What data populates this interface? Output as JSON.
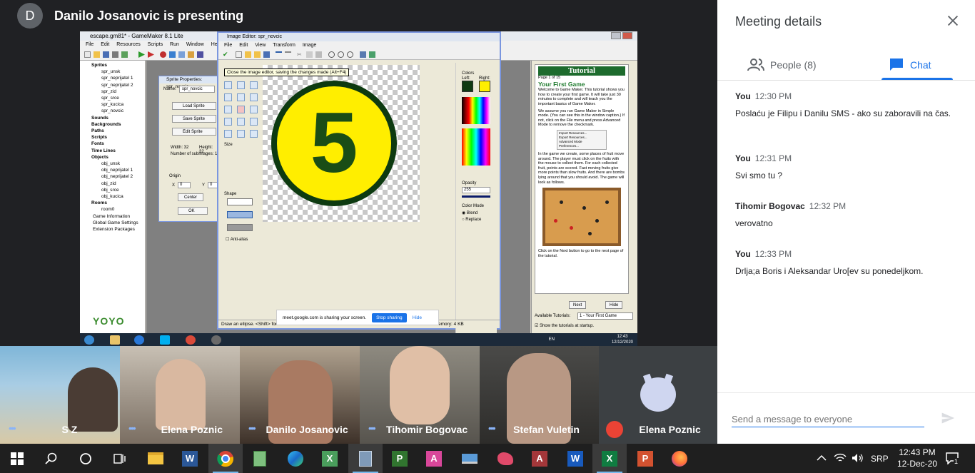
{
  "presenter": {
    "avatar_letter": "D",
    "text": "Danilo Josanovic is presenting"
  },
  "shared_screen": {
    "gm_title": "escape.gm81* - GameMaker 8.1 Lite",
    "gm_menu": [
      "File",
      "Edit",
      "Resources",
      "Scripts",
      "Run",
      "Window",
      "Help"
    ],
    "tree": [
      {
        "label": "Sprites",
        "bold": true
      },
      {
        "label": "spr_unsk",
        "indent": 2
      },
      {
        "label": "spr_neprijatel 1",
        "indent": 2
      },
      {
        "label": "spr_neprijatel 2",
        "indent": 2
      },
      {
        "label": "spr_zid",
        "indent": 2
      },
      {
        "label": "spr_srce",
        "indent": 2
      },
      {
        "label": "spr_kucica",
        "indent": 2
      },
      {
        "label": "spr_novcic",
        "indent": 2
      },
      {
        "label": "Sounds",
        "bold": true
      },
      {
        "label": "Backgrounds",
        "bold": true
      },
      {
        "label": "Paths",
        "bold": true
      },
      {
        "label": "Scripts",
        "bold": true
      },
      {
        "label": "Fonts",
        "bold": true
      },
      {
        "label": "Time Lines",
        "bold": true
      },
      {
        "label": "Objects",
        "bold": true
      },
      {
        "label": "obj_unsk",
        "indent": 2
      },
      {
        "label": "obj_neprijatel 1",
        "indent": 2
      },
      {
        "label": "obj_neprijatel 2",
        "indent": 2
      },
      {
        "label": "obj_zid",
        "indent": 2
      },
      {
        "label": "obj_srce",
        "indent": 2
      },
      {
        "label": "obj_kucica",
        "indent": 2
      },
      {
        "label": "Rooms",
        "bold": true
      },
      {
        "label": "room0",
        "indent": 2
      },
      {
        "label": "Game Information",
        "indent": 1
      },
      {
        "label": "Global Game Settings",
        "indent": 1
      },
      {
        "label": "Extension Packages",
        "indent": 1
      }
    ],
    "yoyo_label": "YOYO",
    "sprite_props": {
      "title": "Sprite Properties: spr_novcic",
      "name_label": "Name:",
      "name_value": "spr_novcic",
      "load_btn": "Load Sprite",
      "save_btn": "Save Sprite",
      "edit_btn": "Edit Sprite",
      "width_text": "Width: 32",
      "height_text": "Height: 32",
      "subimages_text": "Number of subimages: 1",
      "origin_label": "Origin",
      "x_label": "X",
      "x_val": "0",
      "y_label": "Y",
      "y_val": "0",
      "center_btn": "Center",
      "ok_btn": "OK"
    },
    "image_editor": {
      "title": "Image Editor: spr_novcic",
      "menu": [
        "File",
        "Edit",
        "View",
        "Transform",
        "Image"
      ],
      "tooltip": "Close the image editor, saving the changes made (Alt+F4)",
      "size_label": "Size",
      "shape_label": "Shape",
      "antialias": "Anti-alias",
      "colors_label": "Colors",
      "left_label": "Left:",
      "right_label": "Right:",
      "opacity_label": "Opacity",
      "opacity_value": "255",
      "color_mode_label": "Color Mode",
      "blend": "Blend",
      "replace": "Replace",
      "status": "Draw an ellipse. <Shift> for",
      "memory": "emory: 4 KB",
      "left_color": "#0f3a12",
      "right_color": "#ffee00"
    },
    "sharebar": {
      "text": "meet.google.com is sharing your screen.",
      "stop": "Stop sharing",
      "hide": "Hide"
    },
    "tutorial": {
      "header": "Tutorial",
      "page": "Page 1 of 15",
      "heading": "Your First Game",
      "p1": "Welcome to Game Maker. This tutorial shows you how to create your first game. It will take just 30 minutes to complete and will teach you the important basics of Game Maker.",
      "p2": "We assume you run Game Maker in Simple mode. (You can see this in the window caption.) If not, click on the File menu and press Advanced Mode to remove the checkmark.",
      "menu_items": [
        "Import Resources...",
        "Export Resources...",
        "Advanced Mode",
        "Preferences..."
      ],
      "p3": "In the game we create, some places of fruit move around. The player must click on the fruits with the mouse to collect them. For each collected fruit, points are scored. Fast moving fruits give more points than slow fruits. And there are bombs lying around that you should avoid. The game will look as follows.",
      "p4": "Click on the Next button to go to the next page of the tutorial.",
      "next_btn": "Next",
      "hide_btn": "Hide",
      "available_label": "Available Tutorials:",
      "available_value": "1 - Your First Game",
      "show_label": "Show the tutorials at startup."
    },
    "w7_tray": {
      "lang": "EN",
      "time": "12:43",
      "date": "12/12/2020"
    }
  },
  "participants": [
    {
      "name": "S Z",
      "muted": false
    },
    {
      "name": "Elena Poznic",
      "muted": false
    },
    {
      "name": "Danilo Josanovic",
      "muted": false
    },
    {
      "name": "Tihomir Bogovac",
      "muted": false
    },
    {
      "name": "Stefan Vuletin",
      "muted": false
    },
    {
      "name": "Elena Poznic",
      "muted": true
    }
  ],
  "panel": {
    "title": "Meeting details",
    "people_tab": "People (8)",
    "chat_tab": "Chat",
    "messages": [
      {
        "sender": "You",
        "time": "12:30 PM",
        "text": "Poslaću je Filipu i Danilu SMS - ako su zaboravili na čas."
      },
      {
        "sender": "You",
        "time": "12:31 PM",
        "text": "Svi smo tu ?"
      },
      {
        "sender": "Tihomir Bogovac",
        "time": "12:32 PM",
        "text": "verovatno"
      },
      {
        "sender": "You",
        "time": "12:33 PM",
        "text": "Drlja;a Boris i Aleksandar Uro[ev su ponedeljkom."
      }
    ],
    "compose_placeholder": "Send a message to everyone"
  },
  "taskbar": {
    "apps": [
      "start-icon",
      "search-icon",
      "cortana-icon",
      "task-view-icon",
      "file-explorer-icon",
      "word-icon",
      "chrome-icon",
      "notepad-icon",
      "edge-icon",
      "excel-icon",
      "calculator-icon",
      "project-icon",
      "access-icon",
      "laptop-icon",
      "paint-icon",
      "access2-icon",
      "word2-icon",
      "excel2-icon",
      "powerpoint-icon",
      "firefox-icon"
    ],
    "lang": "SRP",
    "time": "12:43 PM",
    "date": "12-Dec-20",
    "notif_count": "1"
  }
}
